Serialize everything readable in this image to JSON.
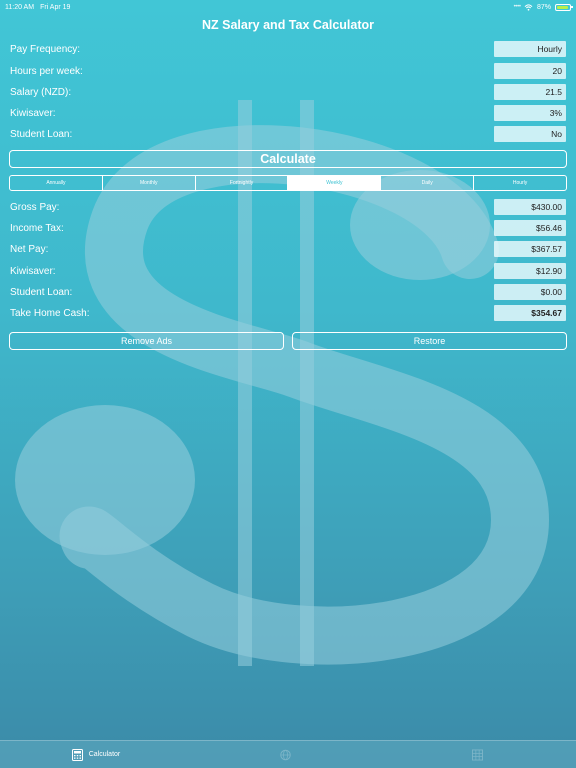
{
  "status": {
    "time": "11:20 AM",
    "date": "Fri Apr 19",
    "battery": "87%"
  },
  "app_title": "NZ Salary and Tax Calculator",
  "inputs": [
    {
      "label": "Pay Frequency:",
      "value": "Hourly"
    },
    {
      "label": "Hours per week:",
      "value": "20"
    },
    {
      "label": "Salary (NZD):",
      "value": "21.5"
    },
    {
      "label": "Kiwisaver:",
      "value": "3%"
    },
    {
      "label": "Student Loan:",
      "value": "No"
    }
  ],
  "calculate_label": "Calculate",
  "periods": [
    "Annually",
    "Monthly",
    "Fortnightly",
    "Weekly",
    "Daily",
    "Hourly"
  ],
  "selected_period": "Weekly",
  "results": [
    {
      "label": "Gross Pay:",
      "value": "$430.00"
    },
    {
      "label": "Income Tax:",
      "value": "$56.46"
    },
    {
      "label": "Net Pay:",
      "value": "$367.57"
    },
    {
      "label": "Kiwisaver:",
      "value": "$12.90"
    },
    {
      "label": "Student Loan:",
      "value": "$0.00"
    },
    {
      "label": "Take Home Cash:",
      "value": "$354.67"
    }
  ],
  "buttons": {
    "remove_ads": "Remove Ads",
    "restore": "Restore"
  },
  "tabs": [
    {
      "label": "Calculator",
      "icon": "calculator-icon",
      "active": true
    },
    {
      "label": "",
      "icon": "globe-icon",
      "active": false
    },
    {
      "label": "",
      "icon": "grid-icon",
      "active": false
    }
  ],
  "colors": {
    "background_top": "#41c6d6",
    "background_bottom": "#3b8aa8",
    "field_background": "#ebfafc",
    "selected_segment_text": "#3fc3d3"
  }
}
